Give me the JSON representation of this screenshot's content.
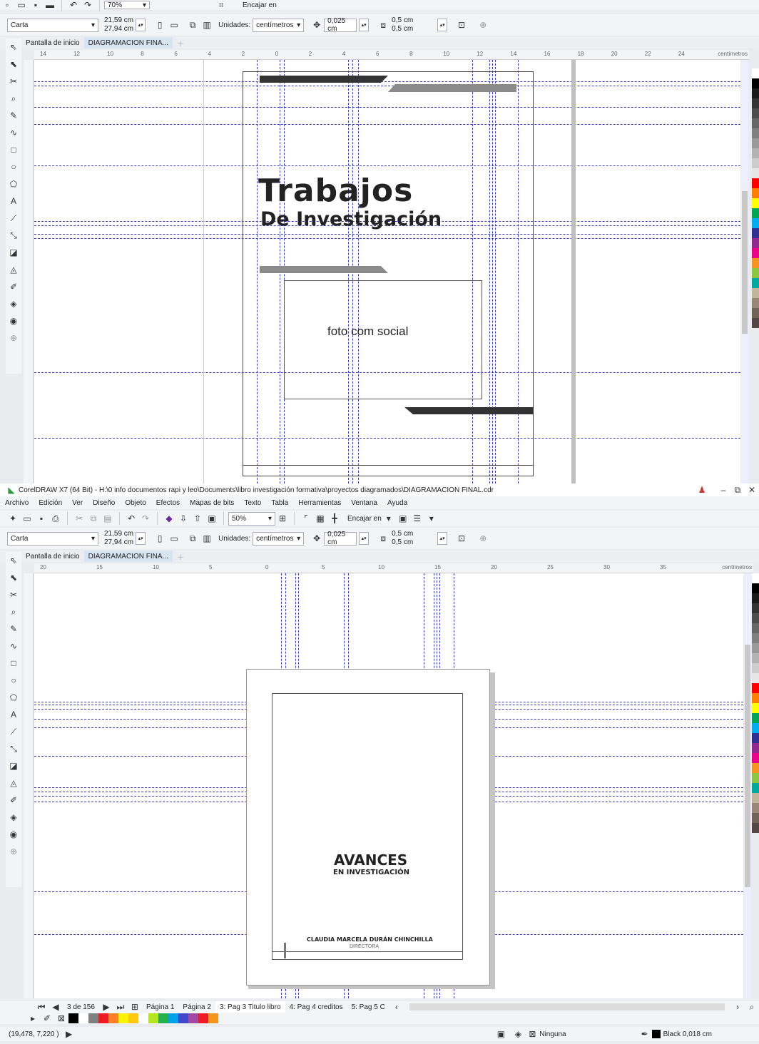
{
  "app": {
    "title": "CorelDRAW X7 (64 Bit) - H:\\0 info documentos rapi y leo\\Documents\\libro investigación formativa\\proyectos diagramados\\DIAGRAMACION FINAL.cdr"
  },
  "menu": [
    "Archivo",
    "Edición",
    "Ver",
    "Diseño",
    "Objeto",
    "Efectos",
    "Mapas de bits",
    "Texto",
    "Tabla",
    "Herramientas",
    "Ventana",
    "Ayuda"
  ],
  "toolbar": {
    "zoom_top": "70%",
    "zoom": "50%",
    "snap_label": "Encajar en"
  },
  "propbar": {
    "paper": "Carta",
    "width": "21,59 cm",
    "height": "27,94 cm",
    "units_label": "Unidades:",
    "units": "centímetros",
    "nudge": "0,025 cm",
    "dup_x": "0,5 cm",
    "dup_y": "0,5 cm"
  },
  "tabs": {
    "home": "Pantalla de inicio",
    "doc": "DIAGRAMACION FINA..."
  },
  "ruler_top": {
    "ticks": [
      "14",
      "12",
      "10",
      "8",
      "6",
      "4",
      "2",
      "0",
      "2",
      "4",
      "6",
      "8",
      "10",
      "12",
      "14",
      "16",
      "18",
      "20",
      "22",
      "24"
    ],
    "unit": "centímetros"
  },
  "ruler_bottom": {
    "ticks": [
      "20",
      "15",
      "10",
      "5",
      "0",
      "5",
      "10",
      "15",
      "20",
      "25",
      "30",
      "35"
    ],
    "unit": "centímetros"
  },
  "page1": {
    "title": "Trabajos",
    "subtitle": "De Investigación",
    "photo_label": "foto com social",
    "colors": {
      "dark_bar": "#333333",
      "gray_bar": "#8a8a8a"
    }
  },
  "page2": {
    "title": "AVANCES",
    "subtitle": "EN INVESTIGACIÓN",
    "author": "CLAUDIA MARCELA DURÁN CHINCHILLA",
    "role": "DIRECTORA"
  },
  "pager": {
    "counter": "3 de 156",
    "pages": [
      "Página 1",
      "Página 2",
      "3: Pag 3 Titulo libro",
      "4: Pag 4 creditos",
      "5: Pag 5 C"
    ]
  },
  "status": {
    "coords": "(19,478, 7,220 )",
    "fill": "Ninguna",
    "outline": "Black  0,018 cm"
  },
  "palette": [
    "#ffffff",
    "#000000",
    "#1a1a1a",
    "#333333",
    "#4d4d4d",
    "#666666",
    "#808080",
    "#999999",
    "#b3b3b3",
    "#cccccc",
    "#e6e6e6",
    "#ff0000",
    "#ff8000",
    "#ffff00",
    "#00a651",
    "#00aeef",
    "#2e3192",
    "#92278f",
    "#ec008c",
    "#f7941d",
    "#8dc63f",
    "#00a99d",
    "#c2b59b",
    "#998675",
    "#736357",
    "#534741"
  ],
  "mini_palette": [
    "#000000",
    "#ffffff",
    "#808080",
    "#ed1c24",
    "#ff7f27",
    "#fff200",
    "#ffc90e",
    "#ffffff",
    "#b5e61d",
    "#22b14c",
    "#00a2e8",
    "#3f48cc",
    "#a349a4",
    "#ed1c24",
    "#f7941d"
  ]
}
